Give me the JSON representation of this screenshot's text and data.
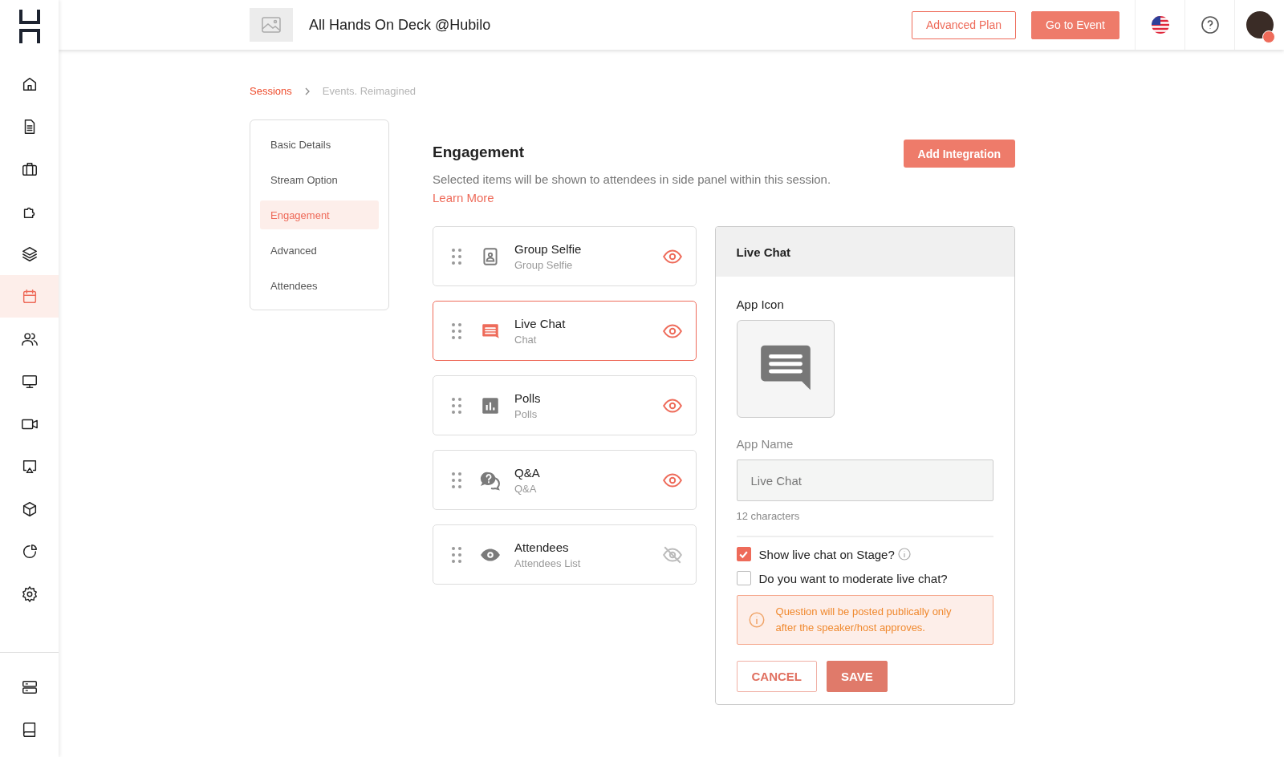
{
  "sidebar": {
    "items": [
      {
        "selected": false
      },
      {
        "selected": false
      },
      {
        "selected": false
      },
      {
        "selected": false
      },
      {
        "selected": false
      },
      {
        "selected": true
      },
      {
        "selected": false
      },
      {
        "selected": false
      },
      {
        "selected": false
      },
      {
        "selected": false
      },
      {
        "selected": false
      },
      {
        "selected": false
      },
      {
        "selected": false
      }
    ],
    "bottom_items": [
      {
        "selected": false
      },
      {
        "selected": false
      }
    ]
  },
  "header": {
    "event_title": "All Hands On Deck @Hubilo",
    "buttons": [
      {
        "label": "Advanced Plan",
        "kind": "outline"
      },
      {
        "label": "Go to Event",
        "kind": "filled"
      }
    ]
  },
  "breadcrumb": [
    "Sessions",
    "Events. Reimagined"
  ],
  "settings_menu": [
    {
      "label": "Basic Details",
      "selected": false
    },
    {
      "label": "Stream Option",
      "selected": false
    },
    {
      "label": "Engagement",
      "selected": true
    },
    {
      "label": "Advanced",
      "selected": false
    },
    {
      "label": "Attendees",
      "selected": false
    }
  ],
  "engagement": {
    "title": "Engagement",
    "description": "Selected items will be shown to attendees in side panel within this session.",
    "learn_more": "Learn More",
    "add_button": "Add Integration",
    "apps": [
      {
        "kind": "selfie",
        "name": "Group Selfie",
        "subtitle": "Group Selfie",
        "selected": false,
        "visible": true
      },
      {
        "kind": "chat",
        "name": "Live Chat",
        "subtitle": "Chat",
        "selected": true,
        "visible": true
      },
      {
        "kind": "polls",
        "name": "Polls",
        "subtitle": "Polls",
        "selected": false,
        "visible": true
      },
      {
        "kind": "qa",
        "name": "Q&A",
        "subtitle": "Q&A",
        "selected": false,
        "visible": true
      },
      {
        "kind": "attendees",
        "name": "Attendees",
        "subtitle": "Attendees List",
        "selected": false,
        "visible": false
      }
    ]
  },
  "panel": {
    "title": "Live Chat",
    "app_icon_label": "App Icon",
    "app_name_label": "App Name",
    "app_name_value": "Live Chat",
    "char_count": "12 characters",
    "options": [
      {
        "label": "Show live chat on Stage?",
        "checked": true,
        "info": true
      },
      {
        "label": "Do you want to moderate live chat?",
        "checked": false,
        "info": false
      }
    ],
    "notice": "Question will be posted publically only after the speaker/host approves.",
    "buttons": [
      {
        "label": "CANCEL",
        "kind": "outline"
      },
      {
        "label": "SAVE",
        "kind": "filled"
      }
    ]
  }
}
